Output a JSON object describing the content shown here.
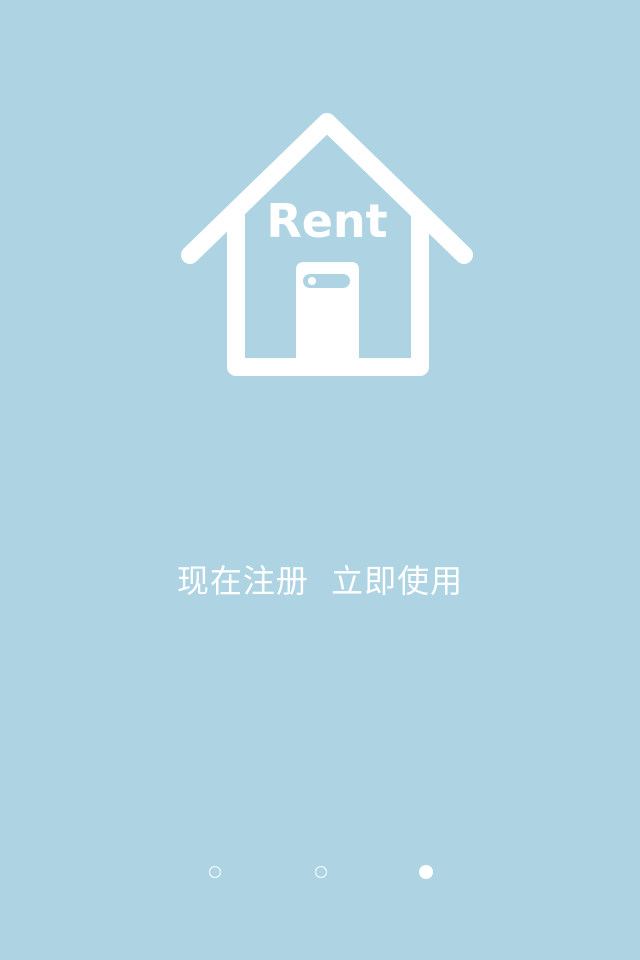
{
  "app": {
    "background_color": "#aed4e3",
    "foreground_color": "#ffffff"
  },
  "logo": {
    "icon": "house-icon",
    "text": "Rent"
  },
  "slogan": {
    "text": "现在注册  立即使用"
  },
  "pager": {
    "total_pages": 3,
    "active_index": 2
  }
}
